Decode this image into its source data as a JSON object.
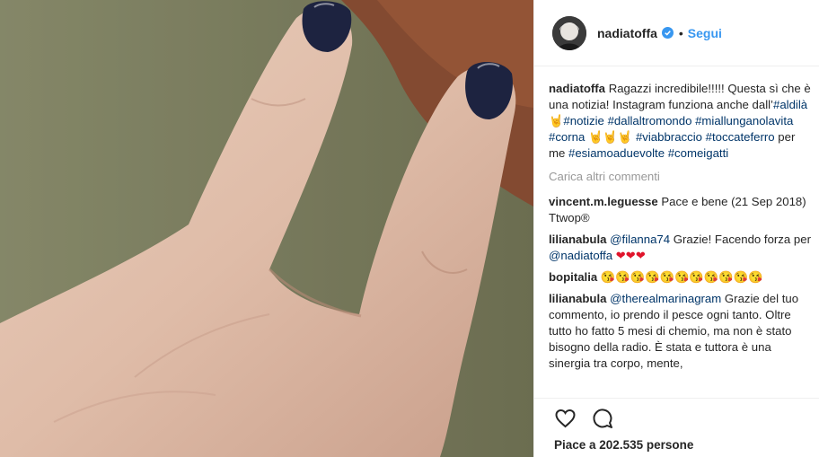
{
  "header": {
    "username": "nadiatoffa",
    "separator": "•",
    "follow_label": "Segui"
  },
  "caption": {
    "username": "nadiatoffa",
    "text1": "Ragazzi incredibile!!!!! Questa sì che è una notizia! Instagram funziona anche dall’",
    "tag_aldila": "#aldilà",
    "horns1": "🤘",
    "tag_notizie": "#notizie",
    "tag_dallaltromondo": "#dallaltromondo",
    "tag_miallunganolavita": "#miallunganolavita",
    "tag_corna": "#corna",
    "horns3": "🤘🤘🤘",
    "tag_viabbraccio": "#viabbraccio",
    "tag_toccateferro": "#toccateferro",
    "text2": "per me",
    "tag_esiamoaduevolte": "#esiamoaduevolte",
    "tag_comeigatti": "#comeigatti"
  },
  "load_more": "Carica altri commenti",
  "comments": [
    {
      "user": "vincent.m.leguesse",
      "text": "Pace e bene (21 Sep 2018) Ttwop®"
    },
    {
      "user": "lilianabula",
      "mention": "@filanna74",
      "text": "Grazie! Facendo forza per",
      "mention2": "@nadiatoffa",
      "hearts": "❤❤❤"
    },
    {
      "user": "bopitalia",
      "text": "😘😘😘😘😘😘😘😘😘😘😘"
    },
    {
      "user": "lilianabula",
      "mention": "@therealmarinagram",
      "text": "Grazie del tuo commento, io prendo il pesce ogni tanto. Oltre tutto ho fatto 5 mesi di chemio, ma non è stato bisogno della radio. È stata e tuttora è una sinergia tra corpo, mente,"
    }
  ],
  "likes_text": "Piace a 202.535 persone",
  "colors": {
    "link": "#003569",
    "follow": "#3897f0",
    "nail": "#1d2340"
  },
  "icons": [
    "heart-outline-icon",
    "comment-bubble-icon",
    "verified-badge-icon"
  ]
}
